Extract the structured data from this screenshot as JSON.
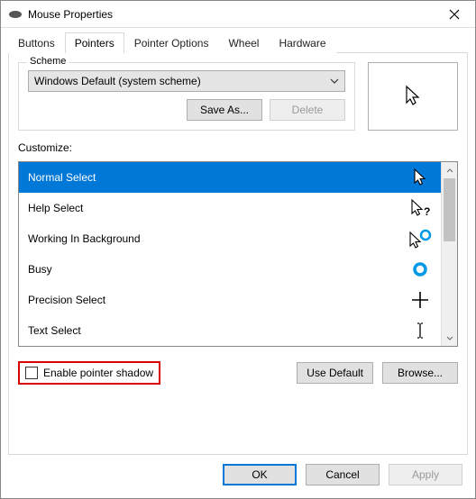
{
  "window": {
    "title": "Mouse Properties"
  },
  "tabs": [
    {
      "label": "Buttons"
    },
    {
      "label": "Pointers"
    },
    {
      "label": "Pointer Options"
    },
    {
      "label": "Wheel"
    },
    {
      "label": "Hardware"
    }
  ],
  "active_tab": 1,
  "scheme": {
    "legend": "Scheme",
    "selected": "Windows Default (system scheme)",
    "save_as_label": "Save As...",
    "delete_label": "Delete"
  },
  "customize_label": "Customize:",
  "cursors": [
    {
      "name": "Normal Select",
      "icon": "arrow",
      "selected": true
    },
    {
      "name": "Help Select",
      "icon": "help-arrow"
    },
    {
      "name": "Working In Background",
      "icon": "arrow-ring"
    },
    {
      "name": "Busy",
      "icon": "ring"
    },
    {
      "name": "Precision Select",
      "icon": "cross"
    },
    {
      "name": "Text Select",
      "icon": "ibeam"
    }
  ],
  "enable_shadow": {
    "label": "Enable pointer shadow",
    "checked": false
  },
  "use_default_label": "Use Default",
  "browse_label": "Browse...",
  "footer": {
    "ok": "OK",
    "cancel": "Cancel",
    "apply": "Apply"
  }
}
